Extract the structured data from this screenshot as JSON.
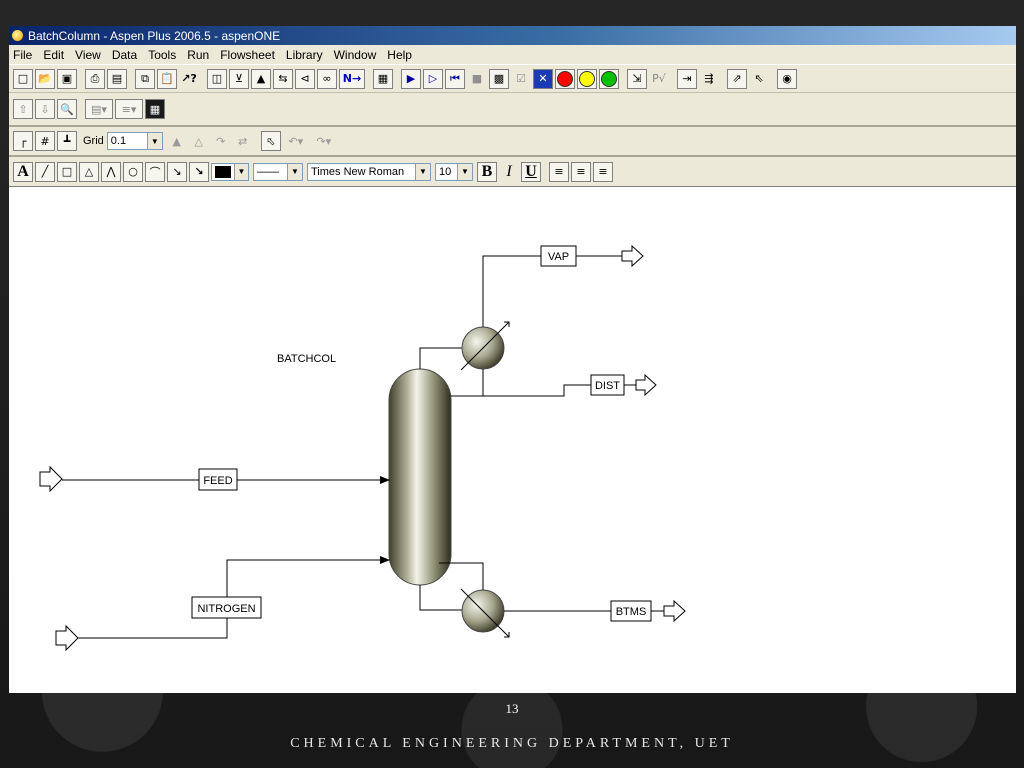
{
  "window": {
    "title": "BatchColumn - Aspen Plus 2006.5 - aspenONE"
  },
  "menu": [
    "File",
    "Edit",
    "View",
    "Data",
    "Tools",
    "Run",
    "Flowsheet",
    "Library",
    "Window",
    "Help"
  ],
  "toolbar": {
    "next_label": "N→",
    "grid_label": "Grid",
    "grid_value": "0.1",
    "font_name": "Times New Roman",
    "font_size": "10",
    "bold_label": "B",
    "italic_label": "I",
    "underline_label": "U",
    "text_tool_label": "A",
    "status_colors": [
      "#ff0000",
      "#ffff00",
      "#00c000"
    ]
  },
  "flowsheet": {
    "block_label": "BATCHCOL",
    "streams": {
      "feed": "FEED",
      "nitrogen": "NITROGEN",
      "vap": "VAP",
      "dist": "DIST",
      "btms": "BTMS"
    }
  },
  "slide": {
    "page_number": "13",
    "department": "CHEMICAL ENGINEERING DEPARTMENT, UET"
  }
}
